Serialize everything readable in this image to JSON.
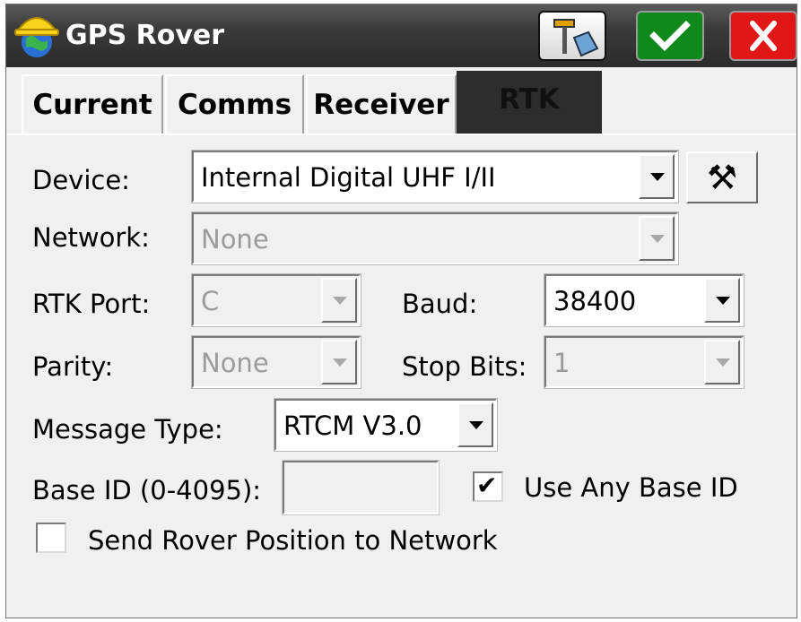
{
  "window": {
    "title": "GPS Rover",
    "app_icon": "hardhat-globe-icon"
  },
  "title_buttons": {
    "gps": "gps-receiver-icon",
    "ok": "checkmark-icon",
    "cancel": "close-icon"
  },
  "tabs": [
    {
      "label": "Current"
    },
    {
      "label": "Comms"
    },
    {
      "label": "Receiver"
    },
    {
      "label": "RTK",
      "selected": true
    }
  ],
  "form": {
    "device_label": "Device:",
    "device_value": "Internal Digital UHF I/II",
    "network_label": "Network:",
    "network_value": "None",
    "rtk_port_label": "RTK Port:",
    "rtk_port_value": "C",
    "baud_label": "Baud:",
    "baud_value": "38400",
    "parity_label": "Parity:",
    "parity_value": "None",
    "stop_bits_label": "Stop Bits:",
    "stop_bits_value": "1",
    "message_type_label": "Message Type:",
    "message_type_value": "RTCM V3.0",
    "base_id_label": "Base ID (0-4095):",
    "base_id_value": "",
    "use_any_base_label": "Use Any Base ID",
    "use_any_base_checked": true,
    "send_rover_label": "Send Rover Position to Network",
    "send_rover_checked": false,
    "tools_icon": "hammer-wrench-icon"
  }
}
